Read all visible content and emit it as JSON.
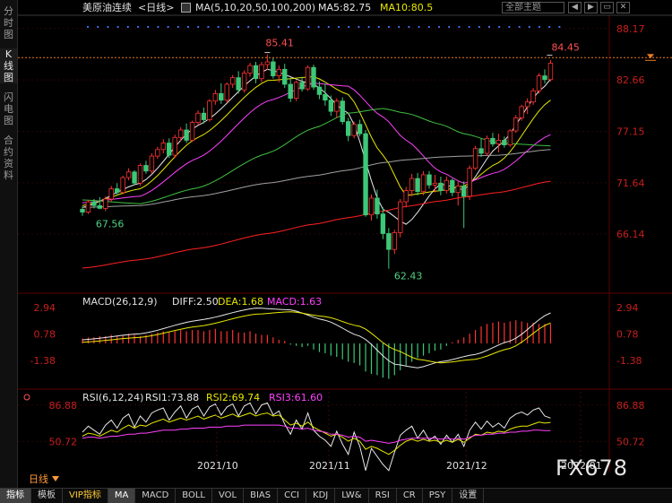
{
  "sidebar": {
    "items": [
      {
        "label": "分时图",
        "chars": [
          "分",
          "时",
          "图"
        ],
        "active": false
      },
      {
        "label": "K线图",
        "chars": [
          "K",
          "线",
          "图"
        ],
        "active": true
      },
      {
        "label": "闪电图",
        "chars": [
          "闪",
          "电",
          "图"
        ],
        "active": false
      },
      {
        "label": "合约资料",
        "chars": [
          "合",
          "约",
          "资",
          "料"
        ],
        "active": false
      }
    ]
  },
  "header": {
    "instrument": "美原油连续",
    "period_tag": "<日线>",
    "ma_params": "MA(5,10,20,50,100,200)",
    "ma5": "MA5:82.75",
    "ma10": "MA10:80.5",
    "search_placeholder": "全部主题",
    "buttons": [
      "◀",
      "▶",
      "▭",
      "✕"
    ]
  },
  "colors": {
    "up": "#ff3232",
    "down": "#3cc878",
    "ma5": "#e8e8e8",
    "ma10": "#e8e800",
    "ma20": "#ff40ff",
    "ma50": "#40c040",
    "ma100": "#a0a0a0",
    "ma200": "#ff2020",
    "axis": "#c81e1e",
    "grid": "#3a0a0a",
    "label_up": "#ff5050",
    "label_down": "#50d080"
  },
  "price_panel": {
    "yticks": [
      "88.17",
      "82.66",
      "77.15",
      "71.64",
      "66.14"
    ],
    "current_marker": "84.45",
    "high_label": "85.41",
    "low_label": "62.43",
    "start_low_label": "67.56"
  },
  "macd_panel": {
    "title": "MACD(26,12,9)",
    "diff": "DIFF:2.50",
    "dea": "DEA:1.68",
    "macd": "MACD:1.63",
    "yticks": [
      "2.94",
      "0.78",
      "-1.38"
    ]
  },
  "rsi_panel": {
    "title": "RSI(6,12,24)",
    "rsi1": "RSI1:73.88",
    "rsi2": "RSI2:69.74",
    "rsi3": "RSI3:61.60",
    "yticks": [
      "86.88",
      "50.72"
    ]
  },
  "time_axis": [
    "2021/10",
    "2021/11",
    "2021/12",
    "2022/01"
  ],
  "period_label": "日线",
  "bottom_tabs": [
    "指标",
    "模板",
    "VIP指标",
    "MA",
    "MACD",
    "BOLL",
    "VOL",
    "BIAS",
    "CCI",
    "KDJ",
    "LW&",
    "RSI",
    "CR",
    "PSY",
    "设置"
  ],
  "active_bottom_tabs": [
    "指标",
    "MA"
  ],
  "watermark": "FX678",
  "chart_data": {
    "type": "candlestick",
    "title": "美原油连续<日线>",
    "ylim": [
      60.0,
      89.5
    ],
    "candles": [
      [
        68.8,
        69.1,
        68.1,
        68.5
      ],
      [
        68.5,
        69.8,
        68.3,
        69.6
      ],
      [
        69.6,
        69.9,
        68.9,
        69.2
      ],
      [
        69.2,
        70.1,
        68.8,
        68.9
      ],
      [
        68.9,
        70.2,
        68.6,
        69.9
      ],
      [
        69.9,
        71.3,
        69.6,
        71.0
      ],
      [
        71.0,
        71.6,
        70.3,
        70.6
      ],
      [
        70.6,
        72.4,
        70.4,
        72.2
      ],
      [
        72.2,
        73.2,
        71.9,
        72.8
      ],
      [
        72.8,
        73.0,
        71.4,
        71.6
      ],
      [
        71.6,
        73.7,
        71.3,
        73.5
      ],
      [
        73.5,
        74.0,
        72.6,
        72.9
      ],
      [
        72.9,
        74.8,
        72.6,
        74.5
      ],
      [
        74.5,
        75.5,
        74.2,
        75.2
      ],
      [
        75.2,
        76.3,
        74.8,
        75.9
      ],
      [
        75.9,
        76.4,
        74.3,
        74.6
      ],
      [
        74.6,
        76.8,
        74.3,
        76.5
      ],
      [
        76.5,
        77.6,
        76.1,
        77.3
      ],
      [
        77.3,
        78.0,
        75.9,
        76.2
      ],
      [
        76.2,
        78.3,
        76.0,
        78.1
      ],
      [
        78.1,
        79.4,
        77.8,
        79.1
      ],
      [
        79.1,
        79.7,
        78.0,
        78.4
      ],
      [
        78.4,
        80.6,
        78.2,
        80.4
      ],
      [
        80.4,
        81.6,
        80.0,
        81.2
      ],
      [
        81.2,
        82.3,
        80.1,
        80.5
      ],
      [
        80.5,
        82.4,
        80.2,
        82.2
      ],
      [
        82.2,
        83.2,
        81.8,
        82.9
      ],
      [
        82.9,
        83.6,
        81.2,
        81.6
      ],
      [
        81.6,
        83.7,
        81.3,
        83.4
      ],
      [
        83.4,
        84.5,
        83.0,
        84.2
      ],
      [
        84.2,
        84.6,
        82.3,
        82.8
      ],
      [
        82.8,
        84.6,
        82.4,
        84.3
      ],
      [
        84.3,
        85.41,
        83.7,
        84.6
      ],
      [
        84.6,
        85.0,
        82.8,
        83.1
      ],
      [
        83.1,
        84.2,
        82.4,
        83.8
      ],
      [
        83.8,
        84.4,
        81.8,
        82.2
      ],
      [
        82.2,
        82.9,
        80.3,
        80.7
      ],
      [
        80.7,
        82.6,
        80.4,
        82.4
      ],
      [
        82.4,
        83.0,
        81.4,
        81.7
      ],
      [
        81.7,
        84.2,
        81.5,
        84.0
      ],
      [
        84.0,
        84.3,
        81.6,
        81.9
      ],
      [
        81.9,
        82.5,
        80.6,
        81.1
      ],
      [
        81.1,
        82.3,
        79.9,
        80.5
      ],
      [
        80.5,
        81.0,
        78.8,
        79.3
      ],
      [
        79.3,
        80.7,
        78.6,
        80.4
      ],
      [
        80.4,
        80.8,
        77.9,
        78.2
      ],
      [
        78.2,
        78.6,
        76.1,
        76.7
      ],
      [
        76.7,
        78.2,
        76.4,
        77.9
      ],
      [
        77.9,
        78.4,
        76.6,
        76.9
      ],
      [
        76.9,
        77.3,
        68.0,
        68.2
      ],
      [
        68.2,
        70.4,
        67.6,
        70.0
      ],
      [
        70.0,
        70.9,
        67.8,
        68.3
      ],
      [
        68.3,
        69.0,
        65.6,
        66.2
      ],
      [
        66.2,
        66.8,
        62.43,
        64.5
      ],
      [
        64.5,
        66.6,
        64.0,
        66.3
      ],
      [
        66.3,
        69.9,
        65.8,
        69.6
      ],
      [
        69.6,
        71.2,
        69.0,
        70.8
      ],
      [
        70.8,
        72.6,
        70.2,
        72.1
      ],
      [
        72.1,
        72.7,
        70.3,
        70.7
      ],
      [
        70.7,
        72.9,
        70.3,
        72.5
      ],
      [
        72.5,
        72.9,
        71.0,
        71.4
      ],
      [
        71.4,
        72.5,
        70.6,
        71.6
      ],
      [
        71.6,
        72.3,
        70.3,
        70.8
      ],
      [
        70.8,
        72.3,
        70.5,
        71.9
      ],
      [
        71.9,
        72.1,
        70.2,
        70.6
      ],
      [
        70.6,
        71.9,
        69.2,
        71.3
      ],
      [
        71.3,
        71.8,
        66.8,
        70.2
      ],
      [
        70.2,
        73.5,
        69.8,
        73.2
      ],
      [
        73.2,
        75.6,
        73.0,
        75.3
      ],
      [
        75.3,
        76.4,
        74.4,
        74.8
      ],
      [
        74.8,
        76.7,
        74.5,
        76.4
      ],
      [
        76.4,
        77.0,
        75.5,
        75.8
      ],
      [
        75.8,
        76.9,
        74.9,
        76.2
      ],
      [
        76.2,
        76.6,
        75.4,
        75.7
      ],
      [
        75.7,
        77.4,
        75.5,
        77.2
      ],
      [
        77.2,
        78.9,
        77.0,
        78.6
      ],
      [
        78.6,
        80.0,
        78.3,
        79.8
      ],
      [
        79.8,
        80.7,
        79.0,
        80.3
      ],
      [
        80.3,
        81.8,
        80.0,
        81.5
      ],
      [
        81.5,
        83.4,
        81.2,
        83.1
      ],
      [
        83.1,
        83.8,
        82.3,
        82.7
      ],
      [
        82.7,
        84.8,
        82.5,
        84.45
      ]
    ],
    "candle_fill": [
      1,
      0,
      1,
      1,
      0,
      0,
      1,
      0,
      0,
      1,
      0,
      1,
      0,
      0,
      0,
      1,
      0,
      0,
      1,
      0,
      0,
      1,
      0,
      0,
      1,
      0,
      0,
      1,
      0,
      0,
      1,
      0,
      0,
      1,
      0,
      1,
      1,
      0,
      1,
      0,
      1,
      1,
      1,
      1,
      0,
      1,
      1,
      0,
      1,
      1,
      0,
      1,
      1,
      0,
      0,
      0,
      0,
      0,
      1,
      0,
      1,
      0,
      1,
      0,
      1,
      0,
      1,
      0,
      0,
      1,
      0,
      1,
      0,
      1,
      0,
      0,
      0,
      0,
      0,
      0,
      1,
      0
    ],
    "ma": {
      "MA5": {
        "start": 69.0,
        "points": [
          [
            0,
            69.0
          ],
          [
            10,
            71.6
          ],
          [
            20,
            77.8
          ],
          [
            32,
            83.8
          ],
          [
            40,
            82.2
          ],
          [
            46,
            79.1
          ],
          [
            52,
            68.8
          ],
          [
            56,
            67.2
          ],
          [
            62,
            71.5
          ],
          [
            66,
            70.9
          ],
          [
            72,
            75.6
          ],
          [
            80,
            82.0
          ],
          [
            81,
            82.75
          ]
        ]
      },
      "MA10": {
        "points": [
          [
            0,
            69.2
          ],
          [
            10,
            71.0
          ],
          [
            20,
            76.5
          ],
          [
            32,
            82.6
          ],
          [
            40,
            83.0
          ],
          [
            46,
            81.1
          ],
          [
            52,
            74.6
          ],
          [
            56,
            70.3
          ],
          [
            62,
            70.8
          ],
          [
            66,
            71.3
          ],
          [
            72,
            73.8
          ],
          [
            81,
            80.5
          ]
        ]
      },
      "MA20": {
        "points": [
          [
            0,
            69.5
          ],
          [
            10,
            70.2
          ],
          [
            20,
            74.3
          ],
          [
            32,
            80.4
          ],
          [
            40,
            82.3
          ],
          [
            46,
            82.0
          ],
          [
            52,
            78.7
          ],
          [
            56,
            76.2
          ],
          [
            62,
            72.8
          ],
          [
            66,
            71.6
          ],
          [
            72,
            72.8
          ],
          [
            81,
            76.8
          ]
        ]
      },
      "MA50": {
        "points": [
          [
            0,
            69.8
          ],
          [
            10,
            69.4
          ],
          [
            20,
            71.1
          ],
          [
            32,
            74.8
          ],
          [
            40,
            77.5
          ],
          [
            46,
            79.1
          ],
          [
            52,
            79.6
          ],
          [
            56,
            79.1
          ],
          [
            62,
            77.9
          ],
          [
            66,
            76.9
          ],
          [
            72,
            75.9
          ],
          [
            81,
            75.6
          ]
        ]
      },
      "MA100": {
        "points": [
          [
            0,
            69.0
          ],
          [
            10,
            69.2
          ],
          [
            20,
            70.2
          ],
          [
            32,
            71.6
          ],
          [
            40,
            72.4
          ],
          [
            46,
            73.0
          ],
          [
            52,
            73.8
          ],
          [
            56,
            74.1
          ],
          [
            62,
            74.4
          ],
          [
            66,
            74.5
          ],
          [
            72,
            74.6
          ],
          [
            81,
            75.2
          ]
        ]
      },
      "MA200": {
        "points": [
          [
            0,
            62.5
          ],
          [
            10,
            63.4
          ],
          [
            20,
            64.6
          ],
          [
            32,
            66.2
          ],
          [
            40,
            67.2
          ],
          [
            46,
            67.9
          ],
          [
            52,
            68.6
          ],
          [
            56,
            69.1
          ],
          [
            62,
            69.7
          ],
          [
            66,
            70.1
          ],
          [
            72,
            70.6
          ],
          [
            81,
            71.8
          ]
        ]
      }
    },
    "macd": {
      "diff": [
        [
          0,
          0.3
        ],
        [
          10,
          0.8
        ],
        [
          20,
          1.9
        ],
        [
          30,
          2.9
        ],
        [
          36,
          2.75
        ],
        [
          42,
          1.9
        ],
        [
          48,
          0.6
        ],
        [
          54,
          -1.7
        ],
        [
          58,
          -2.0
        ],
        [
          62,
          -1.5
        ],
        [
          68,
          -0.9
        ],
        [
          74,
          0.2
        ],
        [
          81,
          2.5
        ]
      ],
      "dea": [
        [
          0,
          0.1
        ],
        [
          10,
          0.5
        ],
        [
          20,
          1.4
        ],
        [
          30,
          2.4
        ],
        [
          36,
          2.6
        ],
        [
          42,
          2.2
        ],
        [
          48,
          1.4
        ],
        [
          54,
          -0.5
        ],
        [
          58,
          -1.3
        ],
        [
          62,
          -1.6
        ],
        [
          68,
          -1.3
        ],
        [
          74,
          -0.4
        ],
        [
          81,
          1.68
        ]
      ],
      "hist": [
        0.4,
        0.5,
        0.5,
        0.6,
        0.6,
        0.7,
        0.6,
        0.7,
        0.8,
        0.7,
        0.6,
        0.7,
        0.8,
        0.9,
        1.0,
        0.9,
        1.0,
        1.1,
        1.0,
        1.1,
        1.1,
        1.0,
        1.1,
        1.2,
        1.0,
        1.0,
        1.1,
        0.9,
        0.9,
        1.0,
        0.8,
        0.7,
        0.7,
        0.5,
        0.3,
        0.2,
        -0.1,
        -0.2,
        -0.3,
        -0.2,
        -0.5,
        -0.7,
        -0.8,
        -1.0,
        -1.1,
        -1.3,
        -1.5,
        -1.6,
        -1.8,
        -2.3,
        -2.5,
        -2.6,
        -2.8,
        -2.9,
        -2.6,
        -2.2,
        -1.8,
        -1.5,
        -1.2,
        -1.0,
        -0.8,
        -0.6,
        -0.5,
        -0.2,
        0.1,
        0.3,
        0.5,
        0.8,
        1.1,
        1.4,
        1.6,
        1.7,
        1.8,
        1.7,
        1.8,
        1.9,
        1.8,
        1.7,
        1.7,
        1.6,
        1.6,
        1.63
      ],
      "ylim": [
        -3.6,
        3.9
      ]
    },
    "rsi": {
      "rsi1": [
        60,
        66,
        62,
        58,
        67,
        72,
        64,
        74,
        78,
        65,
        76,
        70,
        79,
        82,
        84,
        72,
        80,
        86,
        74,
        83,
        86,
        76,
        85,
        88,
        77,
        85,
        88,
        76,
        86,
        89,
        78,
        87,
        89,
        77,
        81,
        68,
        58,
        72,
        63,
        79,
        62,
        56,
        52,
        46,
        61,
        48,
        38,
        60,
        46,
        22,
        44,
        36,
        28,
        22,
        40,
        57,
        62,
        66,
        54,
        62,
        52,
        56,
        48,
        57,
        50,
        58,
        46,
        62,
        70,
        63,
        71,
        65,
        69,
        64,
        74,
        78,
        80,
        77,
        82,
        84,
        76,
        74
      ],
      "rsi2": [
        56,
        59,
        58,
        56,
        59,
        62,
        60,
        64,
        67,
        64,
        67,
        66,
        69,
        71,
        73,
        70,
        72,
        74,
        72,
        74,
        76,
        73,
        75,
        77,
        74,
        76,
        78,
        75,
        77,
        79,
        76,
        78,
        79,
        76,
        77,
        72,
        67,
        69,
        66,
        70,
        65,
        62,
        59,
        56,
        58,
        55,
        51,
        54,
        51,
        43,
        46,
        44,
        41,
        38,
        42,
        47,
        51,
        53,
        51,
        53,
        51,
        52,
        50,
        52,
        50,
        53,
        50,
        54,
        58,
        57,
        60,
        59,
        61,
        60,
        63,
        65,
        66,
        66,
        68,
        70,
        69,
        69.7
      ],
      "rsi3": [
        54,
        55,
        55,
        54,
        55,
        56,
        56,
        57,
        58,
        58,
        59,
        59,
        60,
        61,
        62,
        62,
        62,
        63,
        63,
        64,
        64,
        64,
        65,
        65,
        65,
        66,
        66,
        66,
        67,
        67,
        67,
        67,
        67,
        67,
        67,
        66,
        64,
        64,
        63,
        64,
        62,
        61,
        60,
        58,
        58,
        57,
        55,
        56,
        55,
        51,
        52,
        51,
        50,
        49,
        50,
        52,
        53,
        54,
        54,
        54,
        54,
        54,
        53,
        54,
        53,
        54,
        53,
        55,
        57,
        57,
        58,
        58,
        59,
        59,
        60,
        60,
        61,
        61,
        62,
        62,
        61.5,
        61.6
      ],
      "ylim": [
        20,
        100
      ]
    }
  }
}
